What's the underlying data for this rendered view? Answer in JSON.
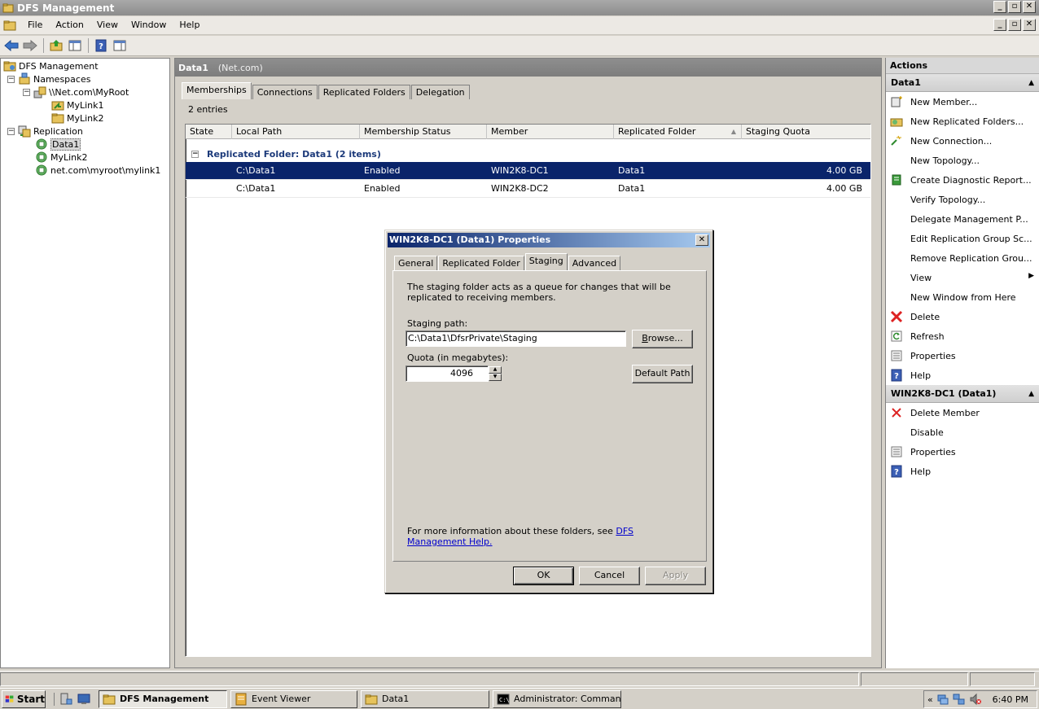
{
  "window": {
    "title": "DFS Management",
    "minimize": "_",
    "maximize": "▫",
    "close": "✕"
  },
  "menu": [
    "File",
    "Action",
    "View",
    "Window",
    "Help"
  ],
  "tree": {
    "root": "DFS Management",
    "namespaces": "Namespaces",
    "namespace_root": "\\\\Net.com\\MyRoot",
    "mylink1": "MyLink1",
    "mylink2": "MyLink2",
    "replication": "Replication",
    "rep_data1": "Data1",
    "rep_mylink2": "MyLink2",
    "rep_mylink1": "net.com\\myroot\\mylink1",
    "toggle_minus": "−"
  },
  "center": {
    "title": "Data1",
    "subtitle": "(Net.com)",
    "tabs": [
      "Memberships",
      "Connections",
      "Replicated Folders",
      "Delegation"
    ],
    "entries": "2 entries",
    "columns": [
      "State",
      "Local Path",
      "Membership Status",
      "Member",
      "Replicated Folder",
      "Staging Quota"
    ],
    "sort_arrow": "▲",
    "group_label": "Replicated Folder: Data1 (2 items)",
    "rows": [
      {
        "state": "",
        "local_path": "C:\\Data1",
        "status": "Enabled",
        "member": "WIN2K8-DC1",
        "folder": "Data1",
        "quota": "4.00 GB"
      },
      {
        "state": "",
        "local_path": "C:\\Data1",
        "status": "Enabled",
        "member": "WIN2K8-DC2",
        "folder": "Data1",
        "quota": "4.00 GB"
      }
    ]
  },
  "actions": {
    "title": "Actions",
    "section1": "Data1",
    "items1": [
      "New Member...",
      "New Replicated Folders...",
      "New Connection...",
      "New Topology...",
      "Create Diagnostic Report...",
      "Verify Topology...",
      "Delegate Management P...",
      "Edit Replication Group Sc...",
      "Remove Replication Grou...",
      "View",
      "New Window from Here",
      "Delete",
      "Refresh",
      "Properties",
      "Help"
    ],
    "section2": "WIN2K8-DC1 (Data1)",
    "items2": [
      "Delete Member",
      "Disable",
      "Properties",
      "Help"
    ],
    "caret": "▲",
    "submenu_arrow": "▶"
  },
  "dialog": {
    "title": "WIN2K8-DC1 (Data1) Properties",
    "close": "✕",
    "tabs": [
      "General",
      "Replicated Folder",
      "Staging",
      "Advanced"
    ],
    "description": "The staging folder acts as a queue for changes that will be replicated to receiving members.",
    "staging_label": "Staging path:",
    "staging_value": "C:\\Data1\\DfsrPrivate\\Staging",
    "browse_prefix": "",
    "browse_key": "B",
    "browse_rest": "rowse...",
    "quota_label": "Quota (in megabytes):",
    "quota_value": "4096",
    "default_path": "Default Path",
    "info_text": "For more information about these folders, see",
    "info_link": "DFS Management Help.",
    "ok": "OK",
    "cancel": "Cancel",
    "apply": "Apply",
    "spin_up": "▲",
    "spin_down": "▼"
  },
  "taskbar": {
    "start": "Start",
    "tasks": [
      "DFS Management",
      "Event Viewer",
      "Data1",
      "Administrator: Command..."
    ],
    "tray_chevron": "«",
    "clock": "6:40 PM"
  },
  "colors": {
    "selection": "#0a246a",
    "group_text": "#1c3a7a",
    "link": "#0000cc"
  }
}
